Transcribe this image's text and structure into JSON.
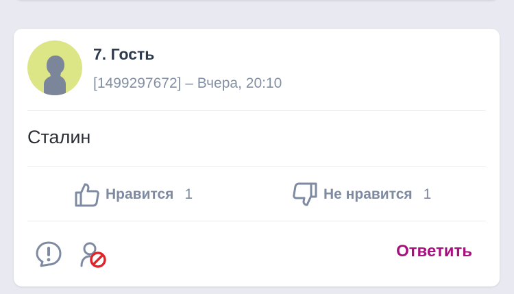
{
  "previous_card": {},
  "comment": {
    "author": "7. Гость",
    "meta": "[1499297672] – Вчера, 20:10",
    "text": "Сталин",
    "avatar_icon": "user-silhouette-icon",
    "colors": {
      "avatar_bg": "#dde687",
      "reply": "#a6117e",
      "icon": "#7d8aa1",
      "block_badge": "#e0242a"
    }
  },
  "votes": {
    "like_label": "Нравится",
    "like_count": "1",
    "like_icon": "thumbs-up-icon",
    "dislike_label": "Не нравится",
    "dislike_count": "1",
    "dislike_icon": "thumbs-down-icon"
  },
  "actions": {
    "report_icon": "exclamation-circle-icon",
    "block_icon": "block-user-icon",
    "reply_label": "Ответить"
  }
}
